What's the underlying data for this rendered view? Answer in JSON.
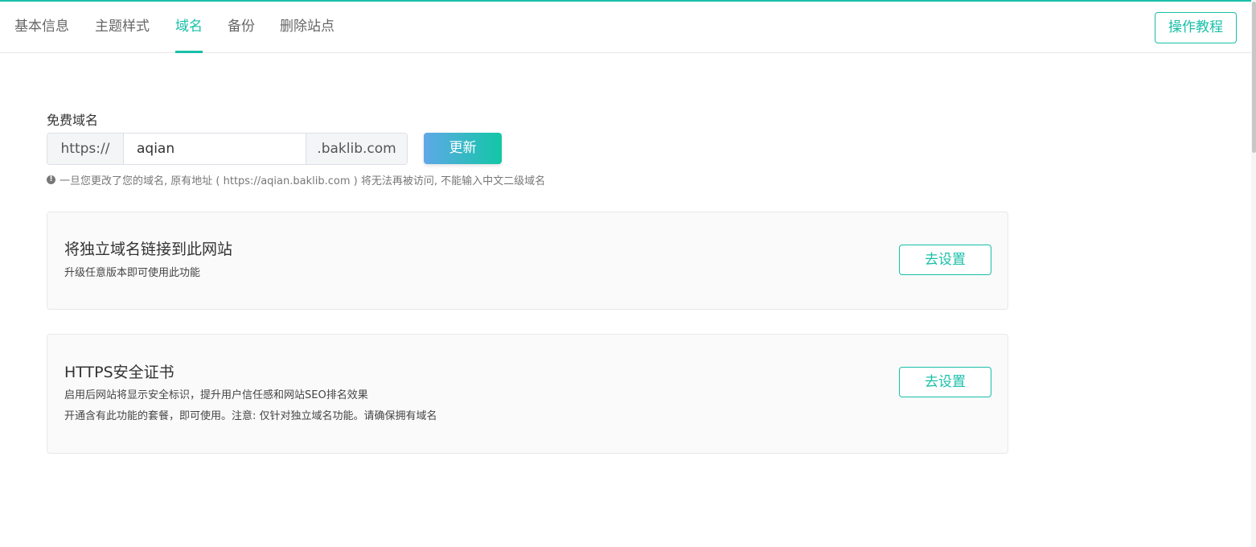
{
  "nav": {
    "tabs": [
      {
        "label": "基本信息",
        "active": false
      },
      {
        "label": "主题样式",
        "active": false
      },
      {
        "label": "域名",
        "active": true
      },
      {
        "label": "备份",
        "active": false
      },
      {
        "label": "删除站点",
        "active": false
      }
    ],
    "tutorial_label": "操作教程"
  },
  "free_domain": {
    "label": "免费域名",
    "prefix": "https://",
    "value": "aqian",
    "suffix": ".baklib.com",
    "update_label": "更新",
    "hint": "一旦您更改了您的域名, 原有地址 ( https://aqian.baklib.com ) 将无法再被访问, 不能输入中文二级域名",
    "hint_icon": "exclamation-circle-icon"
  },
  "custom_domain_card": {
    "title": "将独立域名链接到此网站",
    "desc": "升级任意版本即可使用此功能",
    "button": "去设置"
  },
  "https_card": {
    "title": "HTTPS安全证书",
    "desc1": "启用后网站将显示安全标识，提升用户信任感和网站SEO排名效果",
    "desc2": "开通含有此功能的套餐，即可使用。注意: 仅针对独立域名功能。请确保拥有域名",
    "button": "去设置"
  },
  "colors": {
    "accent": "#19bfa8",
    "gradient_start": "#5fa8e8",
    "gradient_end": "#12c7a6"
  }
}
